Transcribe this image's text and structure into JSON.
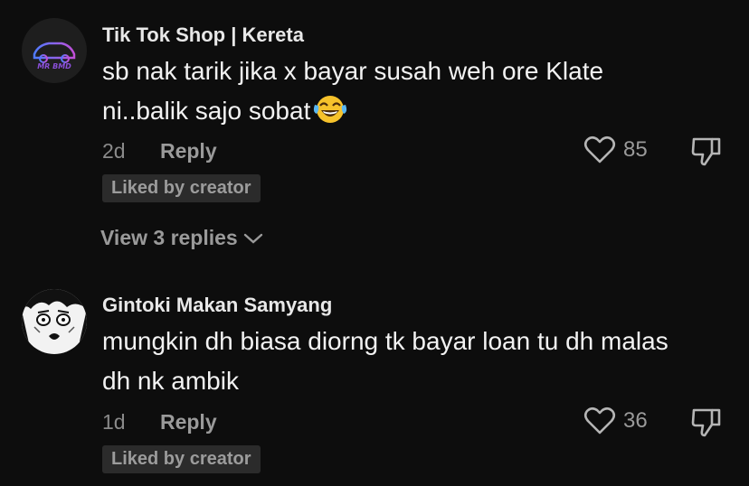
{
  "comments": [
    {
      "username": "Tik Tok Shop | Kereta",
      "avatar_text": "MR BMD",
      "text": "sb nak tarik jika x bayar susah weh ore Klate ni..balik sajo sobat",
      "emoji": "face-with-tears-of-joy",
      "time": "2d",
      "reply_label": "Reply",
      "likes": "85",
      "badge": "Liked by creator",
      "view_replies": "View 3 replies"
    },
    {
      "username": "Gintoki Makan Samyang",
      "text": "mungkin dh biasa diorng tk bayar loan tu dh malas dh nk ambik",
      "time": "1d",
      "reply_label": "Reply",
      "likes": "36",
      "badge": "Liked by creator"
    }
  ],
  "colors": {
    "background": "#0d0d0d",
    "text": "#f2f2f2",
    "muted": "#8a8a8a",
    "badge_bg": "#2b2b2b",
    "avatar_accent": "#8a4fd8"
  }
}
